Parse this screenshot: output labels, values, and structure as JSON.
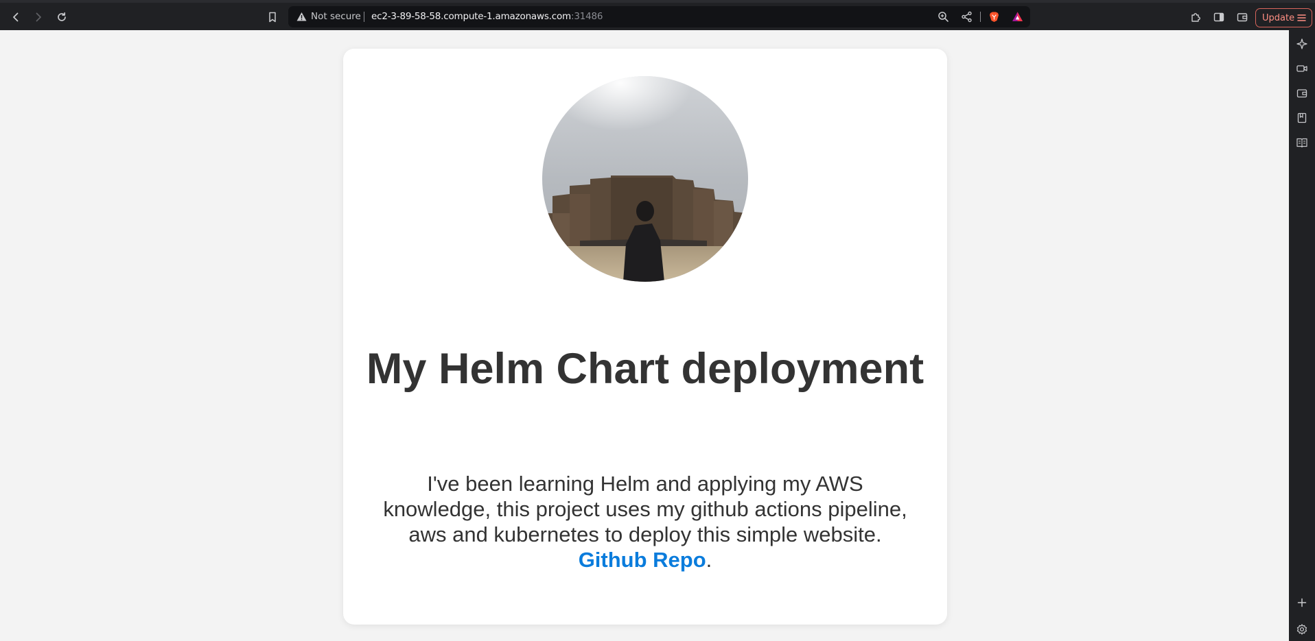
{
  "browser": {
    "security_label": "Not secure",
    "url_host": "ec2-3-89-58-58.compute-1.amazonaws.com",
    "url_port": ":31486",
    "update_label": "Update",
    "colors": {
      "chrome": "#202124",
      "urlbar": "#121316",
      "update_accent": "#ff8f83"
    }
  },
  "page": {
    "avatar_alt": "Profile photo",
    "title": "My Helm Chart deployment",
    "description": "I've been learning Helm and applying my AWS knowledge, this project uses my github actions pipeline, aws and kubernetes to deploy this simple website.",
    "link_label": "Github Repo",
    "trailing_period": ".",
    "colors": {
      "background": "#f3f3f3",
      "card": "#ffffff",
      "text": "#333333",
      "link": "#0a7cdc"
    }
  }
}
